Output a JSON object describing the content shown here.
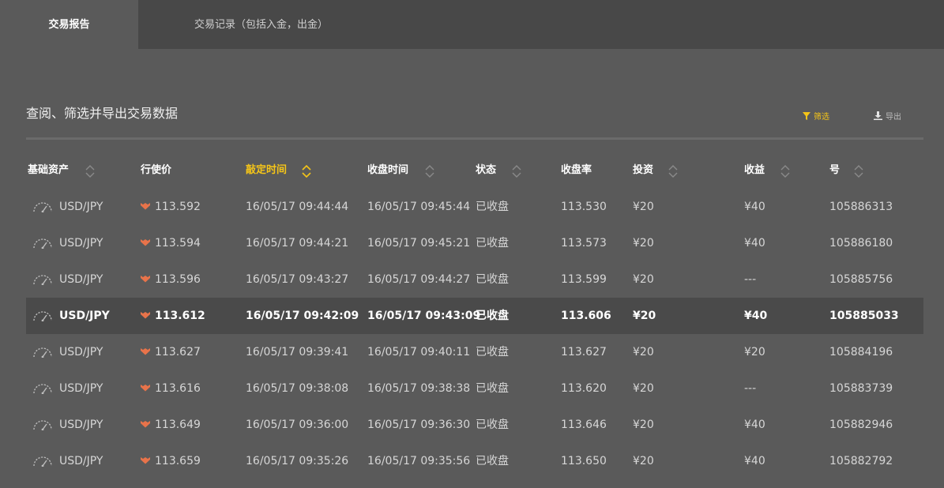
{
  "tabs": [
    {
      "label": "交易报告",
      "active": true
    },
    {
      "label": "交易记录（包括入金，出金）",
      "active": false
    }
  ],
  "page_title": "查阅、筛选并导出交易数据",
  "toolbar": {
    "filter_label": "筛选",
    "filter_icon": "filter-icon",
    "export_label": "导出",
    "export_icon": "download-icon"
  },
  "columns": [
    {
      "label": "基础资产",
      "sortable": true
    },
    {
      "label": "行使价",
      "sortable": false
    },
    {
      "label": "敲定时间",
      "sortable": true,
      "active": true
    },
    {
      "label": "收盘时间",
      "sortable": true
    },
    {
      "label": "状态",
      "sortable": true
    },
    {
      "label": "收盘率",
      "sortable": false
    },
    {
      "label": "投资",
      "sortable": true
    },
    {
      "label": "收益",
      "sortable": true
    },
    {
      "label": "号",
      "sortable": true
    }
  ],
  "rows": [
    {
      "asset": "USD/JPY",
      "strike": "113.592",
      "open_time": "16/05/17 09:44:44",
      "close_time": "16/05/17 09:45:44",
      "status": "已收盘",
      "close_rate": "113.530",
      "investment": "¥20",
      "payout": "¥40",
      "id": "105886313"
    },
    {
      "asset": "USD/JPY",
      "strike": "113.594",
      "open_time": "16/05/17 09:44:21",
      "close_time": "16/05/17 09:45:21",
      "status": "已收盘",
      "close_rate": "113.573",
      "investment": "¥20",
      "payout": "¥40",
      "id": "105886180"
    },
    {
      "asset": "USD/JPY",
      "strike": "113.596",
      "open_time": "16/05/17 09:43:27",
      "close_time": "16/05/17 09:44:27",
      "status": "已收盘",
      "close_rate": "113.599",
      "investment": "¥20",
      "payout": "---",
      "id": "105885756"
    },
    {
      "asset": "USD/JPY",
      "strike": "113.612",
      "open_time": "16/05/17 09:42:09",
      "close_time": "16/05/17 09:43:09",
      "status": "已收盘",
      "close_rate": "113.606",
      "investment": "¥20",
      "payout": "¥40",
      "id": "105885033",
      "highlighted": true
    },
    {
      "asset": "USD/JPY",
      "strike": "113.627",
      "open_time": "16/05/17 09:39:41",
      "close_time": "16/05/17 09:40:11",
      "status": "已收盘",
      "close_rate": "113.627",
      "investment": "¥20",
      "payout": "¥20",
      "id": "105884196"
    },
    {
      "asset": "USD/JPY",
      "strike": "113.616",
      "open_time": "16/05/17 09:38:08",
      "close_time": "16/05/17 09:38:38",
      "status": "已收盘",
      "close_rate": "113.620",
      "investment": "¥20",
      "payout": "---",
      "id": "105883739"
    },
    {
      "asset": "USD/JPY",
      "strike": "113.649",
      "open_time": "16/05/17 09:36:00",
      "close_time": "16/05/17 09:36:30",
      "status": "已收盘",
      "close_rate": "113.646",
      "investment": "¥20",
      "payout": "¥40",
      "id": "105882946"
    },
    {
      "asset": "USD/JPY",
      "strike": "113.659",
      "open_time": "16/05/17 09:35:26",
      "close_time": "16/05/17 09:35:56",
      "status": "已收盘",
      "close_rate": "113.650",
      "investment": "¥20",
      "payout": "¥40",
      "id": "105882792"
    }
  ],
  "icons": {
    "asset_icon": "speedometer-icon",
    "direction_icon": "down-arrow-icon"
  },
  "colors": {
    "accent": "#f5c518",
    "down_arrow": "#e8734a",
    "background": "#5a5a5a",
    "tab_bar": "#484848"
  }
}
